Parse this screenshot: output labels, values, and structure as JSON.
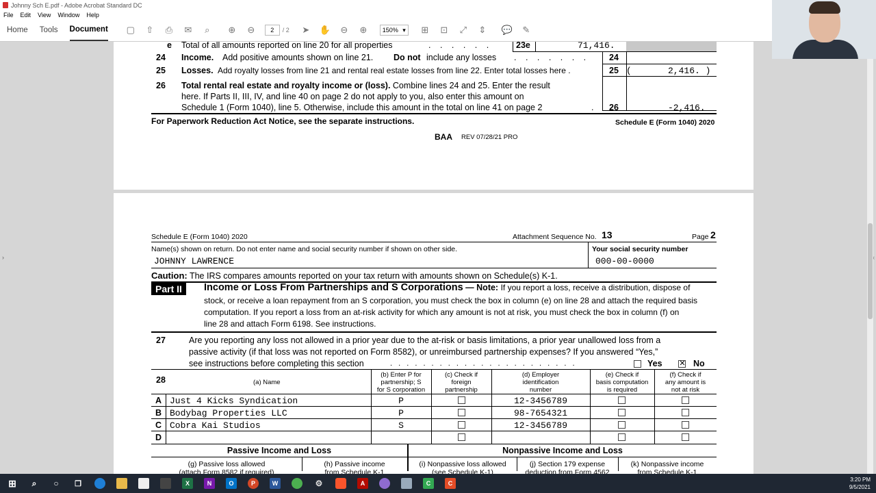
{
  "window": {
    "title": "Johnny Sch E.pdf - Adobe Acrobat Standard DC"
  },
  "menu": [
    "File",
    "Edit",
    "View",
    "Window",
    "Help"
  ],
  "toolbar": {
    "tabs": [
      "Home",
      "Tools",
      "Document"
    ],
    "page_current": "2",
    "page_total": "/ 2",
    "zoom": "150%"
  },
  "page1": {
    "line23e": {
      "num": "e",
      "text": "Total of all amounts reported on line 20 for all properties",
      "dots": ". . . . . .",
      "box": "23e",
      "amount": "71,416."
    },
    "line24": {
      "num": "24",
      "bold": "Income.",
      "text": "Add positive amounts shown on line 21.",
      "bold2": "Do not",
      "text2": "include any losses",
      "dots": ". . . . . . .",
      "box": "24"
    },
    "line25": {
      "num": "25",
      "bold": "Losses.",
      "text": "Add royalty losses from line 21 and rental real estate losses from line 22. Enter total losses here .",
      "box": "25",
      "paren_open": "(",
      "amount": "2,416. )"
    },
    "line26": {
      "num": "26",
      "bold": "Total rental real estate and royalty income or (loss).",
      "text1": "Combine lines 24 and 25. Enter the result",
      "text2": "here. If Parts II, III, IV, and line 40 on page 2 do not apply to you, also enter this amount on",
      "text3": "Schedule 1 (Form 1040), line 5. Otherwise, include this amount in the total on line 41 on page 2",
      "dot": ".",
      "box": "26",
      "amount": "-2,416."
    },
    "footer_left": "For Paperwork Reduction Act Notice, see the separate instructions.",
    "footer_right": "Schedule E (Form 1040) 2020",
    "baa": "BAA",
    "rev": "REV 07/28/21 PRO"
  },
  "page2": {
    "header_left": "Schedule E (Form 1040) 2020",
    "header_mid": "Attachment Sequence No.",
    "header_seq": "13",
    "header_page": "Page",
    "header_page_num": "2",
    "names_label": "Name(s) shown on return. Do not enter name and social security number if shown on other side.",
    "ssn_label": "Your social security number",
    "name": "JOHNNY LAWRENCE",
    "ssn": "000-00-0000",
    "caution_bold": "Caution:",
    "caution_text": "The IRS compares amounts reported on your tax return with amounts shown on Schedule(s) K-1.",
    "part_tag": "Part II",
    "part_title": "Income or Loss From Partnerships and S Corporations",
    "part_dash": "—",
    "note_bold": "Note:",
    "note1": "If you report a loss, receive a distribution, dispose of",
    "note2": "stock, or receive a loan repayment from an S corporation, you must check the box in column (e) on line 28 and attach the required basis",
    "note3": "computation. If you report a loss from an at-risk activity for which  any amount is not at risk, you must check the box in column (f) on",
    "note4": "line 28 and attach Form 6198. See instructions.",
    "q27": {
      "num": "27",
      "line1": "Are you reporting any loss not allowed in a prior year due to the at-risk or basis limitations, a prior year unallowed loss from a",
      "line2": "passive activity (if that loss was not reported on Form 8582), or unreimbursed partnership expenses? If you answered “Yes,”",
      "line3": "see instructions before completing this section",
      "dots": ". . . . . . . . . . . . . . . . . . . . . . .",
      "yes": "Yes",
      "no": "No",
      "yes_checked": false,
      "no_checked": true
    },
    "table28": {
      "num": "28",
      "col_a": "(a) Name",
      "col_b": [
        "(b) Enter P for",
        "partnership; S",
        "for S corporation"
      ],
      "col_c": [
        "(c) Check if",
        "foreign",
        "partnership"
      ],
      "col_d": [
        "(d) Employer",
        "identification",
        "number"
      ],
      "col_e": [
        "(e) Check if",
        "basis computation",
        "is required"
      ],
      "col_f": [
        "(f) Check if",
        "any amount is",
        "not at risk"
      ],
      "rows": [
        {
          "letter": "A",
          "name": "Just 4 Kicks Syndication",
          "type": "P",
          "ein": "12-3456789"
        },
        {
          "letter": "B",
          "name": "Bodybag Properties LLC",
          "type": "P",
          "ein": "98-7654321"
        },
        {
          "letter": "C",
          "name": "Cobra Kai Studios",
          "type": "S",
          "ein": "12-3456789"
        },
        {
          "letter": "D",
          "name": "",
          "type": "",
          "ein": ""
        }
      ]
    },
    "passive_title": "Passive Income and Loss",
    "nonpassive_title": "Nonpassive Income and Loss",
    "sub_g": [
      "(g) Passive loss allowed",
      "(attach Form 8582 if required)"
    ],
    "sub_h": [
      "(h) Passive income",
      "from Schedule K-1"
    ],
    "sub_i": [
      "(i) Nonpassive loss allowed",
      "(see Schedule K-1)"
    ],
    "sub_j": [
      "(j) Section 179 expense",
      "deduction from Form 4562"
    ],
    "sub_k": [
      "(k) Nonpassive income",
      "from Schedule K-1"
    ]
  },
  "taskbar": {
    "time": "3:20 PM",
    "date": "9/5/2021"
  }
}
